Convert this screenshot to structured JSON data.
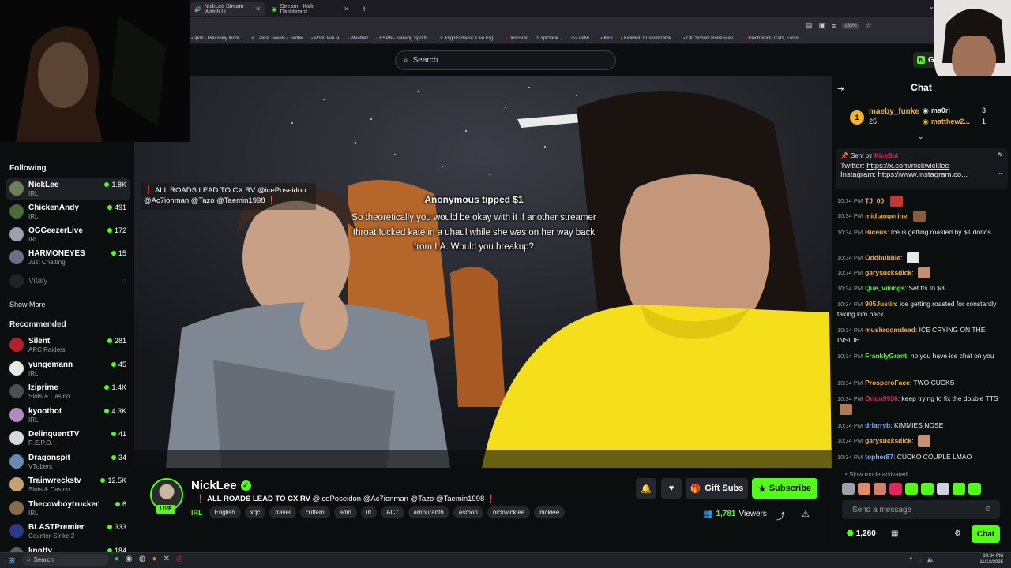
{
  "browser": {
    "tabs": [
      {
        "label": "NickLee Stream - Watch Li"
      },
      {
        "label": "Stream - Kick Dashboard"
      }
    ],
    "zoom": "133%",
    "bookmarks": [
      "/pol/ - Politically Incor...",
      "Latest Tweets / Twitter",
      "Pomf.lain.la",
      "Weather",
      "ESPN - Serving Sports...",
      "Flightradar24: Live Flig...",
      "Unscored",
      "spictank ........ ip7.netw...",
      "Kick",
      "KickBot: Customizable...",
      "Old School RuneScap...",
      "Electronics, Cars, Fashi..."
    ]
  },
  "header": {
    "search_placeholder": "Search",
    "get_label": "Get"
  },
  "sidebar": {
    "following_title": "Following",
    "following": [
      {
        "name": "NickLee",
        "category": "IRL",
        "viewers": "1.8K",
        "color": "#6b7f5a"
      },
      {
        "name": "ChickenAndy",
        "category": "IRL",
        "viewers": "491",
        "color": "#4a6b3a"
      },
      {
        "name": "OGGeezerLive",
        "category": "IRL",
        "viewers": "172",
        "color": "#9aa3ad"
      },
      {
        "name": "HARMONEYES",
        "category": "Just Chatting",
        "viewers": "15",
        "color": "#6a6f8a"
      },
      {
        "name": "Vitaly",
        "category": "",
        "viewers": "",
        "color": "#3a3f44"
      }
    ],
    "show_more": "Show More",
    "recommended_title": "Recommended",
    "recommended": [
      {
        "name": "Silent",
        "category": "ARC Raiders",
        "viewers": "281",
        "color": "#b3202a"
      },
      {
        "name": "yungemann",
        "category": "IRL",
        "viewers": "45",
        "color": "#e8e8e8"
      },
      {
        "name": "Iziprime",
        "category": "Slots & Casino",
        "viewers": "1.4K",
        "color": "#4a4f54"
      },
      {
        "name": "kyootbot",
        "category": "IRL",
        "viewers": "4.3K",
        "color": "#b08ac0"
      },
      {
        "name": "DelinquentTV",
        "category": "R.E.P.O.",
        "viewers": "41",
        "color": "#d8d8d8"
      },
      {
        "name": "Dragonspit",
        "category": "VTubers",
        "viewers": "34",
        "color": "#6a8ab0"
      },
      {
        "name": "Trainwreckstv",
        "category": "Slots & Casino",
        "viewers": "12.5K",
        "color": "#c8a070"
      },
      {
        "name": "Thecowboytrucker",
        "category": "IRL",
        "viewers": "6",
        "color": "#8a6a4a"
      },
      {
        "name": "BLASTPremier",
        "category": "Counter-Strike 2",
        "viewers": "333",
        "color": "#2a3a8a"
      },
      {
        "name": "knotty",
        "category": "",
        "viewers": "184",
        "color": "#5a5f64"
      }
    ]
  },
  "video": {
    "overlay_title": "❗ ALL ROADS LEAD TO CX RV @icePoseidon @Ac7ionman @Tazo @Taemin1998 ❗",
    "tip_title": "Anonymous tipped $1",
    "tip_message": "So theoretically you would be okay with it if another streamer throat fucked kate in a uhaul while she was on her way back from LA. Would you breakup?"
  },
  "stream": {
    "name": "NickLee",
    "live_label": "LIVE",
    "title_prefix": "❗ ALL ROADS LEAD TO CX RV",
    "title_mentions": "@icePoseidon @Ac7ionman @Tazo @Taemin1998 ❗",
    "category": "IRL",
    "tags": [
      "English",
      "xqc",
      "travel",
      "cuffem",
      "adin",
      "irl",
      "AC7",
      "amouranth",
      "asmon",
      "nickwicklee",
      "nickiee"
    ],
    "gift_subs_label": "Gift Subs",
    "subscribe_label": "Subscribe",
    "viewers_count": "1,781",
    "viewers_label": "Viewers"
  },
  "chat": {
    "title": "Chat",
    "leaderboard": {
      "first": {
        "rank": "1",
        "name": "maeby_funke",
        "count": "25"
      },
      "second": {
        "name": "ma0ri",
        "count": "3"
      },
      "third": {
        "name": "matthew2...",
        "count": "1"
      }
    },
    "pinned": {
      "sent_by_label": "Sent by",
      "sender": "KickBot",
      "twitter_label": "Twitter:",
      "twitter_url": "https://x.com/nickwicklee",
      "instagram_label": "Instagram:",
      "instagram_url": "https://www.instagram.co..."
    },
    "messages": [
      {
        "time": "10:34 PM",
        "user": "TJ_00",
        "text": "",
        "color": "#f2b233",
        "emote": "#c0392b"
      },
      {
        "time": "10:34 PM",
        "user": "midtangerine",
        "text": "",
        "color": "#f2b233",
        "emote": "#8a5a3a"
      },
      {
        "time": "10:34 PM",
        "user": "Biceus",
        "text": "Ice is getting roasted by $1 donos",
        "color": "#f2b233"
      },
      {
        "time": "10:34 PM",
        "user": "Oddbubble",
        "text": "",
        "color": "#f2b233",
        "emote": "#e8e8e8"
      },
      {
        "time": "10:34 PM",
        "user": "garysucksdick",
        "text": "",
        "color": "#f2b233",
        "emote": "#c89070"
      },
      {
        "time": "10:34 PM",
        "user": "Que_vikings",
        "text": "Set tts to $3",
        "color": "#53fc18"
      },
      {
        "time": "10:34 PM",
        "user": "905Justin",
        "text": "ice getting roasted for constantly taking kim back",
        "color": "#f2b233"
      },
      {
        "time": "10:34 PM",
        "user": "mushroomdead",
        "text": "ICE CRYING ON THE INSIDE",
        "color": "#f2b233"
      },
      {
        "time": "10:34 PM",
        "user": "FranklyGrant",
        "text": "no you have ice chat on you",
        "color": "#53fc18"
      },
      {
        "time": "10:34 PM",
        "user": "ProsperoFace",
        "text": "TWO CUCKS",
        "color": "#f2b233"
      },
      {
        "time": "10:34 PM",
        "user": "Orion9936",
        "text": "keep trying to fix the double TTS",
        "color": "#e0265e",
        "emote": "#b07a5a"
      },
      {
        "time": "10:34 PM",
        "user": "drlarryb",
        "text": "KIMMIES NOSE",
        "color": "#7fb2ff"
      },
      {
        "time": "10:34 PM",
        "user": "garysucksdick",
        "text": "",
        "color": "#f2b233",
        "emote": "#c89070"
      },
      {
        "time": "10:34 PM",
        "user": "topher87",
        "text": "CUCKO COUPLE LMAO",
        "color": "#7fb2ff"
      }
    ],
    "slow_mode": "Slow mode activated",
    "input_placeholder": "Send a message",
    "points": "1,260",
    "send_label": "Chat"
  },
  "taskbar": {
    "search_placeholder": "Search",
    "time": "10:34 PM",
    "date": "11/12/2025"
  }
}
